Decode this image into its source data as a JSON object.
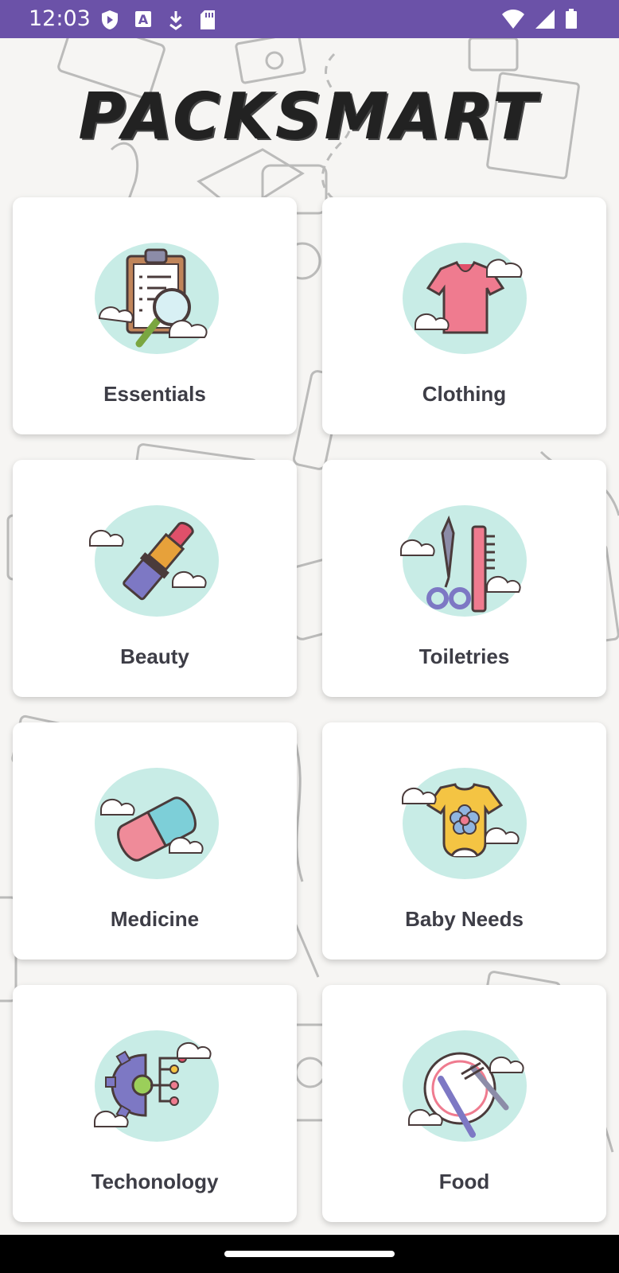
{
  "status_bar": {
    "time": "12:03",
    "left_icons": [
      "shield-icon",
      "font-a-icon",
      "download-icon",
      "sd-card-icon"
    ],
    "right_icons": [
      "wifi-icon",
      "signal-icon",
      "battery-icon"
    ]
  },
  "app": {
    "title": "PACKSMART"
  },
  "categories": [
    {
      "label": "Essentials",
      "icon": "clipboard-icon"
    },
    {
      "label": "Clothing",
      "icon": "tshirt-icon"
    },
    {
      "label": "Beauty",
      "icon": "lipstick-icon"
    },
    {
      "label": "Toiletries",
      "icon": "scissors-comb-icon"
    },
    {
      "label": "Medicine",
      "icon": "pill-icon"
    },
    {
      "label": "Baby Needs",
      "icon": "baby-onesie-icon"
    },
    {
      "label": "Techonology",
      "icon": "gear-circuit-icon"
    },
    {
      "label": "Food",
      "icon": "plate-fork-knife-icon"
    }
  ],
  "colors": {
    "status_bar": "#6b52a8",
    "background": "#f6f5f3",
    "label": "#3d3d46",
    "icon_blob": "#c8ece6"
  }
}
